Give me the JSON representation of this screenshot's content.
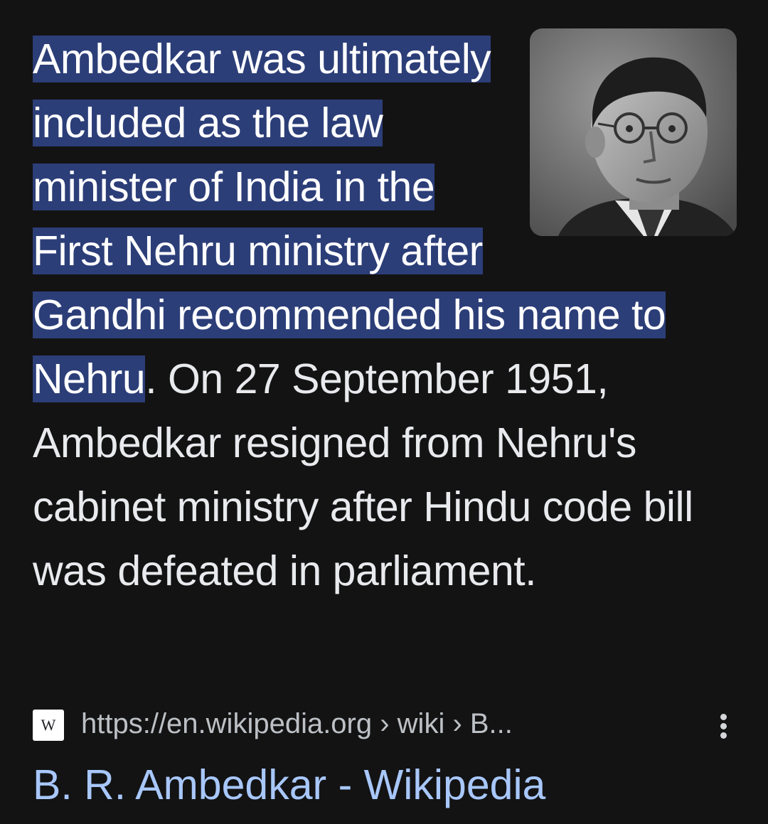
{
  "snippet": {
    "highlighted_text": "Ambedkar was ultimately included as the law minister of India in the First Nehru ministry after Gandhi recommended his name to Nehru",
    "rest_text": ". On 27 September 1951, Ambedkar resigned from Nehru's cabinet ministry after Hindu code bill was defeated in parliament."
  },
  "thumbnail": {
    "subject": "B. R. Ambedkar portrait photo"
  },
  "source": {
    "favicon_letter": "W",
    "url": "https://en.wikipedia.org › wiki › B...",
    "more_icon": "more-vert-icon"
  },
  "result": {
    "title": "B. R. Ambedkar - Wikipedia"
  },
  "colors": {
    "background": "#131314",
    "highlight": "#2c3e78",
    "link": "#a8c7fa"
  }
}
